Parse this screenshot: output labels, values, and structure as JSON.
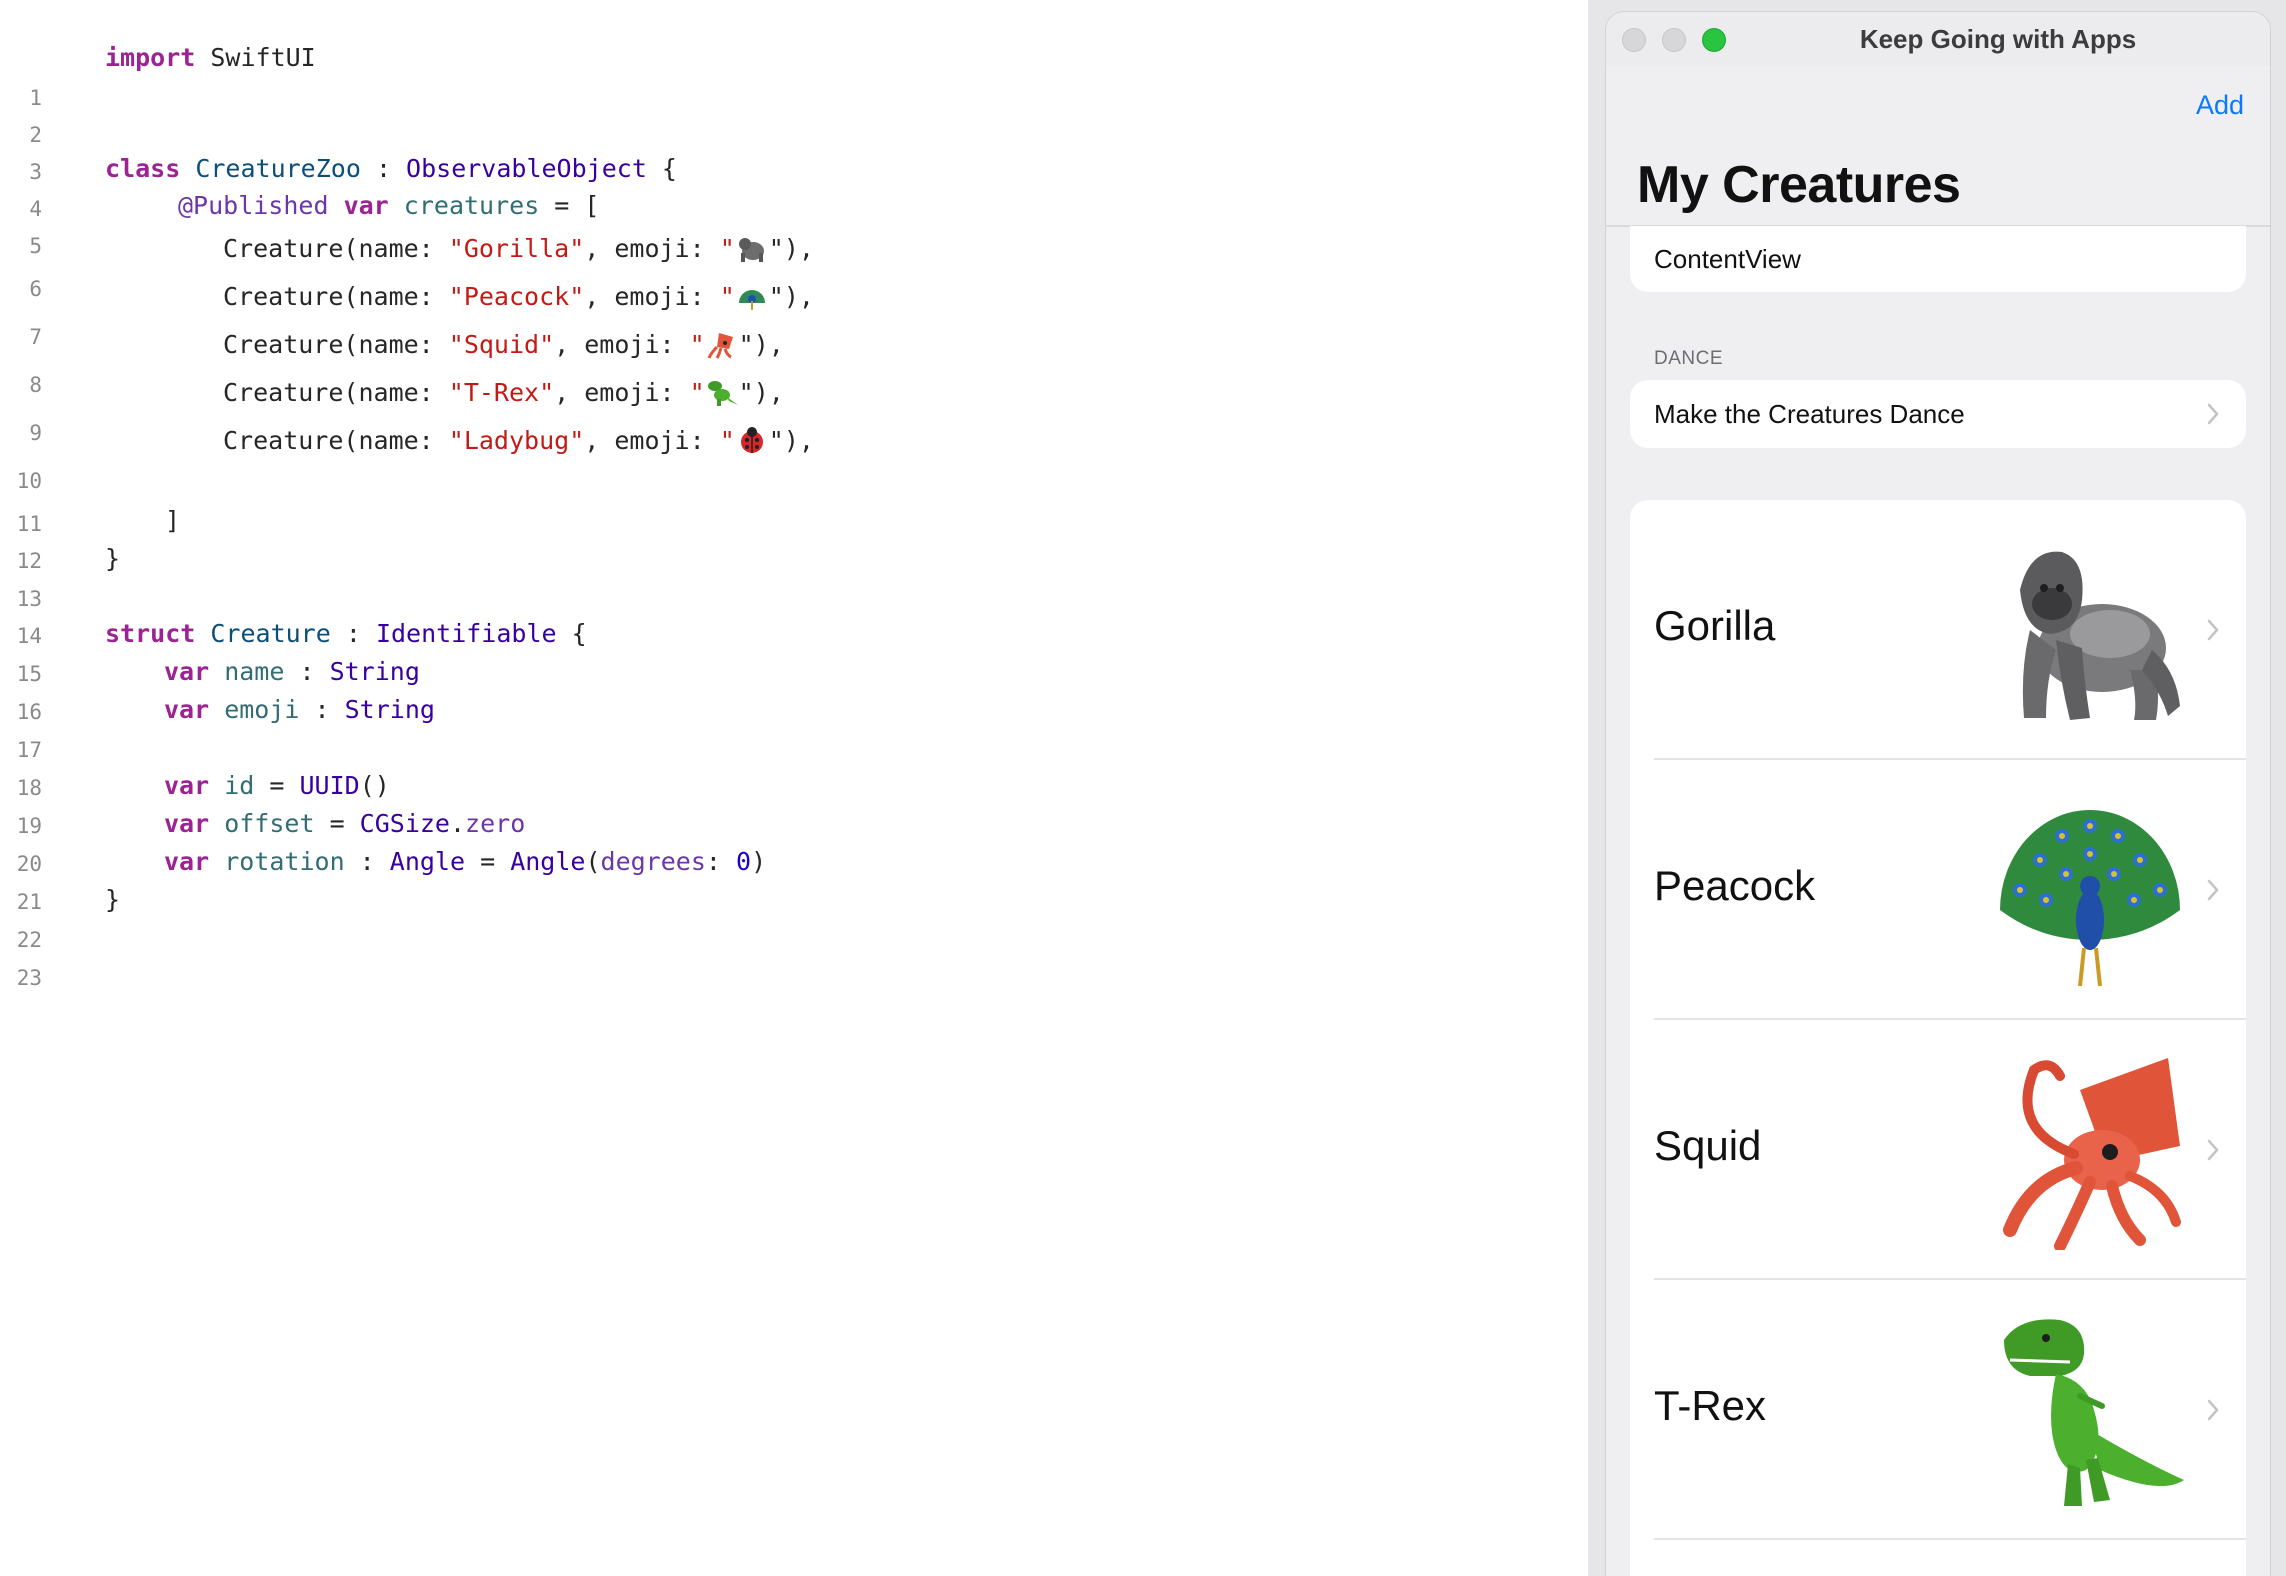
{
  "editor": {
    "lines": [
      {
        "n": "1"
      },
      {
        "n": "2"
      },
      {
        "n": "3"
      },
      {
        "n": "4"
      },
      {
        "n": "5"
      },
      {
        "n": "6"
      },
      {
        "n": "7"
      },
      {
        "n": "8"
      },
      {
        "n": "9"
      },
      {
        "n": "10"
      },
      {
        "n": "11"
      },
      {
        "n": "12"
      },
      {
        "n": "13"
      },
      {
        "n": "14"
      },
      {
        "n": "15"
      },
      {
        "n": "16"
      },
      {
        "n": "17"
      },
      {
        "n": "18"
      },
      {
        "n": "19"
      },
      {
        "n": "20"
      },
      {
        "n": "21"
      },
      {
        "n": "22"
      },
      {
        "n": "23"
      }
    ],
    "tokens": {
      "import": "import",
      "swiftui": " SwiftUI",
      "class": "class",
      "creature_zoo": " CreatureZoo",
      "colon": " : ",
      "observable": "ObservableObject",
      "brace_open": " {",
      "published": "@Published",
      "var": "var",
      "creatures": " creatures",
      "eq_bracket": " = [",
      "creature_call": "Creature(name: ",
      "emoji_arg": ", emoji: ",
      "quote": "\"",
      "close_call": "\"),",
      "name_gorilla": "\"Gorilla\"",
      "name_peacock": "\"Peacock\"",
      "name_squid": "\"Squid\"",
      "name_trex": "\"T-Rex\"",
      "name_ladybug": "\"Ladybug\"",
      "bracket_close": "]",
      "brace_close": "}",
      "struct": "struct",
      "creature": " Creature",
      "identifiable": "Identifiable",
      "name": " name",
      "string": "String",
      "emoji": " emoji",
      "id": " id",
      "eq": " = ",
      "uuid": "UUID",
      "parens": "()",
      "offset": " offset",
      "cgsize": "CGSize",
      "dot": ".",
      "zero": "zero",
      "rotation": " rotation",
      "angle": "Angle",
      "paren_open": "(",
      "degrees": "degrees",
      "colon_sp": ": ",
      "zero_num": "0",
      "paren_close": ")"
    }
  },
  "window": {
    "title": "Keep Going with Apps",
    "add_label": "Add",
    "nav_title": "My Creatures",
    "content_view_label": "ContentView",
    "dance_section": "DANCE",
    "dance_label": "Make the Creatures Dance",
    "creatures": [
      {
        "name": "Gorilla",
        "icon": "gorilla-emoji"
      },
      {
        "name": "Peacock",
        "icon": "peacock-emoji"
      },
      {
        "name": "Squid",
        "icon": "squid-emoji"
      },
      {
        "name": "T-Rex",
        "icon": "trex-emoji"
      }
    ]
  },
  "colors": {
    "accent": "#0a7aff",
    "keyword": "#9b2393",
    "string": "#c41a16",
    "type": "#3900a0",
    "zoom_light": "#29c440"
  }
}
